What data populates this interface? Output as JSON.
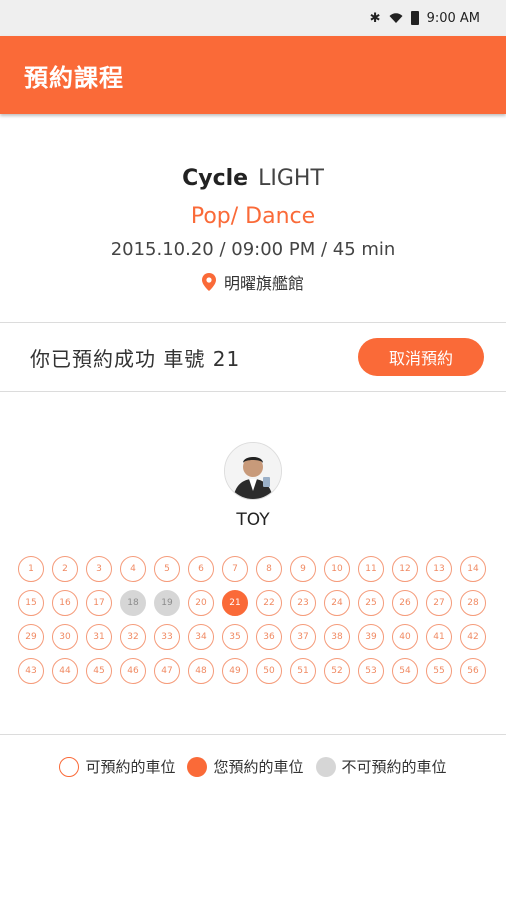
{
  "status_bar": {
    "time": "9:00 AM",
    "icons": [
      "bluetooth-icon",
      "wifi-icon",
      "battery-icon"
    ]
  },
  "app_bar": {
    "title": "預約課程"
  },
  "course": {
    "name": "Cycle",
    "level": "LIGHT",
    "genre": "Pop/ Dance",
    "datetime": "2015.10.20 / 09:00 PM / 45 min",
    "location": "明曜旗艦館"
  },
  "booking": {
    "message": "你已預約成功 車號 21",
    "cancel_label": "取消預約"
  },
  "instructor": {
    "name": "TOY"
  },
  "seats": {
    "rows": [
      [
        "1",
        "2",
        "3",
        "4",
        "5",
        "6",
        "7",
        "8",
        "9",
        "10",
        "11",
        "12",
        "13",
        "14"
      ],
      [
        "15",
        "16",
        "17",
        "18",
        "19",
        "20",
        "21",
        "22",
        "23",
        "24",
        "25",
        "26",
        "27",
        "28"
      ],
      [
        "29",
        "30",
        "31",
        "32",
        "33",
        "34",
        "35",
        "36",
        "37",
        "38",
        "39",
        "40",
        "41",
        "42"
      ],
      [
        "43",
        "44",
        "45",
        "46",
        "47",
        "48",
        "49",
        "50",
        "51",
        "52",
        "53",
        "54",
        "55",
        "56"
      ]
    ],
    "taken": [
      "18",
      "19"
    ],
    "mine": "21"
  },
  "legend": {
    "open_label": "可預約的車位",
    "mine_label": "您預約的車位",
    "taken_label": "不可預約的車位"
  },
  "colors": {
    "accent": "#fa6a38",
    "taken": "#d6d6d6"
  }
}
